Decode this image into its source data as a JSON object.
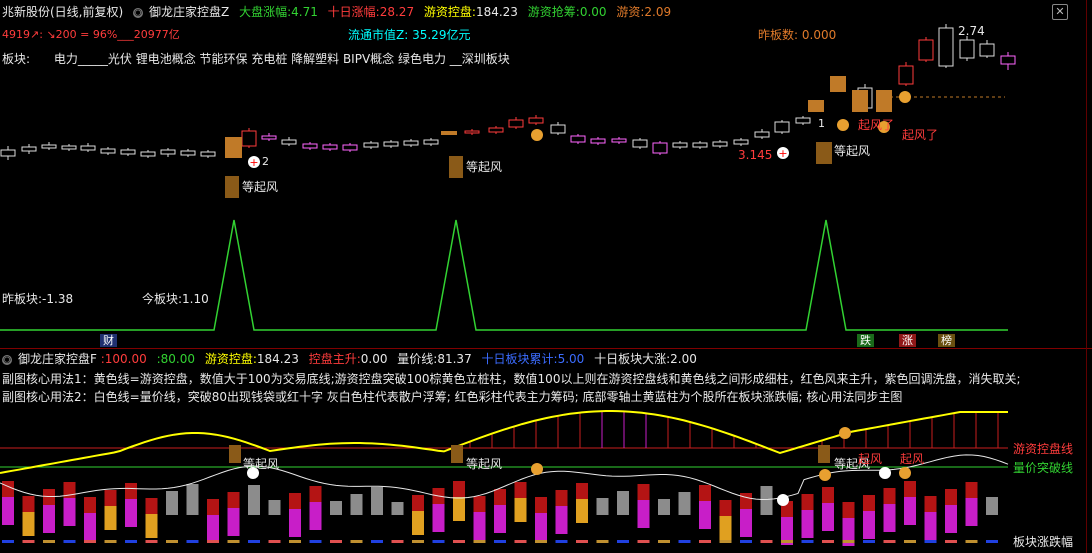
{
  "header": {
    "stock_name": "兆新股份(日线,前复权)",
    "indicator_icon": "circle-dropdown-icon",
    "indicator_name": "御龙庄家控盘Z",
    "market_label": "大盘涨幅:",
    "market_value": "4.71",
    "ten_day_label": "十日涨幅:",
    "ten_day_value": "28.27",
    "hot_label": "游资控盘:",
    "hot_value": "184.23",
    "grab_label": "游资抢筹:",
    "grab_value": "0.00",
    "hot2_label": "游资:",
    "hot2_value": "2.09"
  },
  "info_line": {
    "left_text": "4919↗:  ↘200 = 96%___20977亿",
    "float_cap_label": "流通市值Z:",
    "float_cap_value": "35.29亿元",
    "yesterday_board_label": "昨板数:",
    "yesterday_board_value": "0.000"
  },
  "sector_line": {
    "label": "板块:",
    "items": "电力_____光伏 锂电池概念 节能环保 充电桩 降解塑料 BIPV概念 绿色电力 __深圳板块"
  },
  "main_chart_labels": {
    "price_high": "2.74",
    "price_low": "3.145",
    "waiting1": "等起风",
    "waiting2": "等起风",
    "waiting3": "等起风",
    "fly_label": "起风了",
    "fly_label2": "起风了",
    "left_arrow_value": "2",
    "code_label": "1",
    "yesterday_block": "昨板块:-1.38",
    "today_block": "今板块:1.10"
  },
  "bottom_tags": {
    "cai": "财",
    "die": "跌",
    "zhang": "涨",
    "bang": "榜"
  },
  "sub_header": {
    "indicator_name": "御龙庄家控盘F",
    "v1": ":100.00",
    "v2": ":80.00",
    "hot_label": "游资控盘:",
    "hot_value": "184.23",
    "rise_label": "控盘主升:",
    "rise_value": "0.00",
    "volprice_label": "量价线:",
    "volprice_value": "81.37",
    "ten_block_label": "十日板块累计:",
    "ten_block_value": "5.00",
    "ten_block_rise_label": "十日板块大涨:",
    "ten_block_rise_value": "2.00"
  },
  "usage_text": {
    "line1": "副图核心用法1：黄色线=游资控盘，数值大于100为交易底线;游资控盘突破100棕黄色立桩柱，数值100以上则在游资控盘线和黄色线之间形成细柱，红色风来主升，紫色回调洗盘，消失取关;",
    "line2": "副图核心用法2：白色线=量价线，突破80出现钱袋或红十字   灰白色柱代表散户浮筹;  红色彩柱代表主力筹码;  底部零轴土黄蓝柱为个股所在板块涨跌幅;  核心用法同步主图"
  },
  "sub_chart_labels": {
    "hot_line": "游资控盘线",
    "break_line": "量价突破线",
    "block_rise": "板块涨跌幅",
    "waiting1": "等起风",
    "waiting2": "等起风",
    "waiting3": "等起风",
    "fly1": "起风",
    "fly2": "起风"
  },
  "colors": {
    "background": "#000000",
    "up_candle": "#ff3c3c",
    "down_candle": "#dcdcdc",
    "accent_yellow": "#ffff00",
    "accent_green": "#32d232",
    "accent_orange": "#c07a28",
    "accent_magenta": "#c81ec8"
  }
}
